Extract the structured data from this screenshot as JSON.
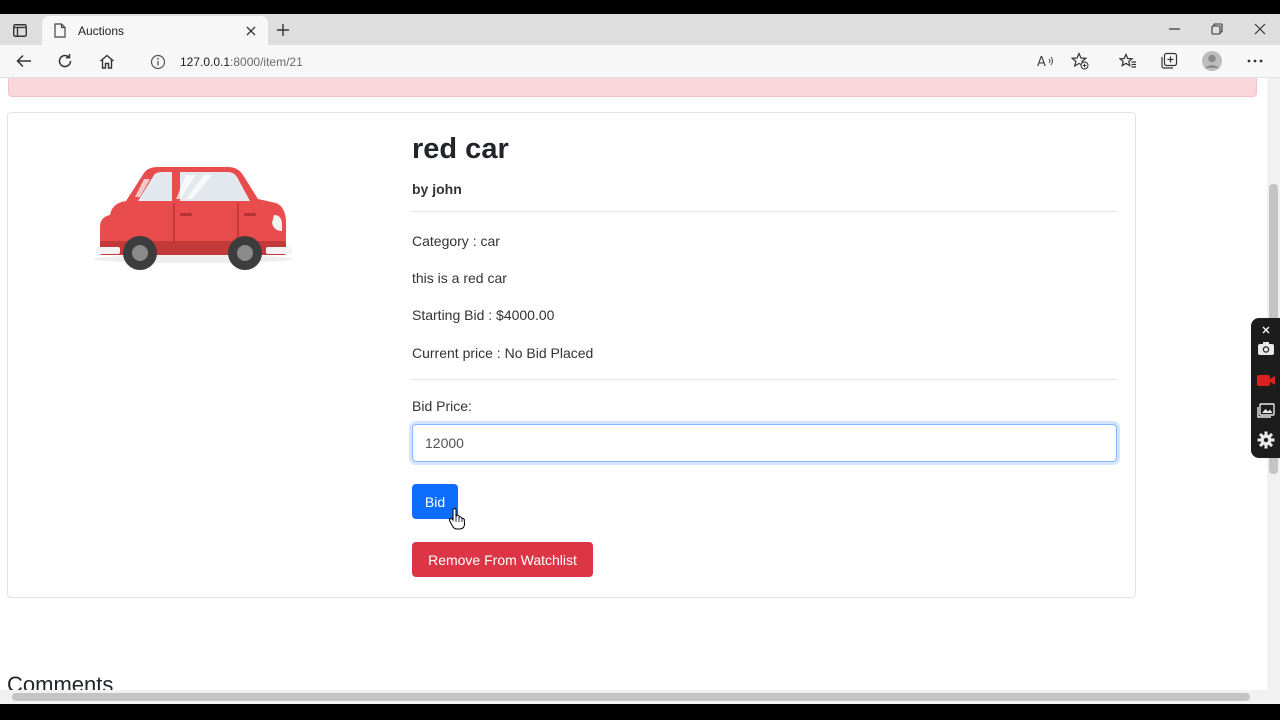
{
  "browser": {
    "tab_title": "Auctions",
    "url_host": "127.0.0.1",
    "url_rest": ":8000/item/21"
  },
  "item": {
    "title": "red car",
    "by": "by john",
    "category": "Category : car",
    "description": "this is a red car",
    "starting_bid": "Starting Bid : $4000.00",
    "current_price": "Current price : No Bid Placed"
  },
  "bid_form": {
    "label": "Bid Price:",
    "value": "12000",
    "submit_label": "Bid"
  },
  "watchlist": {
    "remove_label": "Remove From Watchlist"
  },
  "comments": {
    "heading": "Comments"
  },
  "colors": {
    "primary": "#0d6efd",
    "danger": "#dc3545",
    "alert_bg": "#f8d7da",
    "car_red": "#e84c4c"
  }
}
